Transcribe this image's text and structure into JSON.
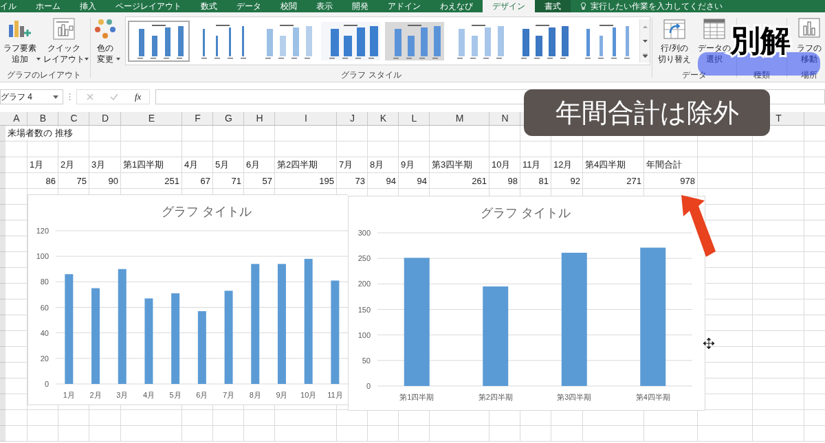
{
  "ribbon_tabs": [
    {
      "label": "イル",
      "selected": false,
      "contextual": false
    },
    {
      "label": "ホーム",
      "selected": false,
      "contextual": false
    },
    {
      "label": "挿入",
      "selected": false,
      "contextual": false
    },
    {
      "label": "ページレイアウト",
      "selected": false,
      "contextual": false
    },
    {
      "label": "数式",
      "selected": false,
      "contextual": false
    },
    {
      "label": "データ",
      "selected": false,
      "contextual": false
    },
    {
      "label": "校閲",
      "selected": false,
      "contextual": false
    },
    {
      "label": "表示",
      "selected": false,
      "contextual": false
    },
    {
      "label": "開発",
      "selected": false,
      "contextual": false
    },
    {
      "label": "アドイン",
      "selected": false,
      "contextual": false
    },
    {
      "label": "わえなび",
      "selected": false,
      "contextual": false
    },
    {
      "label": "デザイン",
      "selected": true,
      "contextual": true
    },
    {
      "label": "書式",
      "selected": false,
      "contextual": true
    }
  ],
  "tell_me": {
    "placeholder": "実行したい作業を入力してください"
  },
  "ribbon": {
    "layout_group": {
      "label": "グラフのレイアウト",
      "buttons": [
        {
          "lines": [
            "ラフ要素",
            "追加"
          ],
          "kind": "elements"
        },
        {
          "lines": [
            "クイック",
            "レイアウト"
          ],
          "kind": "layout"
        }
      ]
    },
    "style_group": {
      "label": "グラフ スタイル",
      "color_button": {
        "lines": [
          "色の",
          "変更"
        ]
      },
      "styles": [
        {
          "selected": true
        },
        {
          "selected": false
        },
        {
          "selected": false
        },
        {
          "selected": false
        },
        {
          "selected": false
        },
        {
          "selected": false
        },
        {
          "selected": false
        },
        {
          "selected": false
        }
      ]
    },
    "data_group": {
      "label": "データ",
      "buttons": [
        {
          "lines": [
            "行/列の",
            "切り替え"
          ],
          "kind": "switch"
        },
        {
          "lines": [
            "データの",
            "選択"
          ],
          "kind": "select"
        }
      ]
    },
    "type_group": {
      "label": "種類"
    },
    "location_group": {
      "label": "場所",
      "button": {
        "lines": [
          "ラフの",
          "移動"
        ]
      }
    }
  },
  "formula_bar": {
    "name_box": "グラフ 4",
    "function_label": "fx"
  },
  "column_headers": [
    "A",
    "B",
    "C",
    "D",
    "E",
    "F",
    "G",
    "H",
    "I",
    "J",
    "K",
    "L",
    "M",
    "N"
  ],
  "column_headers_right": [
    "T"
  ],
  "rows": [
    {
      "cells": [
        {
          "text": "来場者数の 推移",
          "kind": "text"
        },
        null,
        null,
        null,
        null,
        null,
        null,
        null,
        null,
        null,
        null,
        null,
        null,
        null,
        null,
        null,
        null,
        null,
        null,
        null
      ]
    },
    {
      "cells": [
        null,
        null,
        null,
        null,
        null,
        null,
        null,
        null,
        null,
        null,
        null,
        null,
        null,
        null,
        null,
        null,
        null,
        null,
        null,
        null
      ]
    },
    {
      "cells": [
        null,
        {
          "text": "1月",
          "kind": "text"
        },
        {
          "text": "2月",
          "kind": "text"
        },
        {
          "text": "3月",
          "kind": "text"
        },
        {
          "text": "第1四半期",
          "kind": "text"
        },
        {
          "text": "4月",
          "kind": "text"
        },
        {
          "text": "5月",
          "kind": "text"
        },
        {
          "text": "6月",
          "kind": "text"
        },
        {
          "text": "第2四半期",
          "kind": "text"
        },
        {
          "text": "7月",
          "kind": "text"
        },
        {
          "text": "8月",
          "kind": "text"
        },
        {
          "text": "9月",
          "kind": "text"
        },
        {
          "text": "第3四半期",
          "kind": "text"
        },
        {
          "text": "10月",
          "kind": "text"
        },
        {
          "text": "11月",
          "kind": "text"
        },
        {
          "text": "12月",
          "kind": "text"
        },
        {
          "text": "第4四半期",
          "kind": "text"
        },
        {
          "text": "年間合計",
          "kind": "text"
        },
        null,
        null
      ]
    },
    {
      "cells": [
        null,
        {
          "text": "86",
          "kind": "number"
        },
        {
          "text": "75",
          "kind": "number"
        },
        {
          "text": "90",
          "kind": "number"
        },
        {
          "text": "251",
          "kind": "number"
        },
        {
          "text": "67",
          "kind": "number"
        },
        {
          "text": "71",
          "kind": "number"
        },
        {
          "text": "57",
          "kind": "number"
        },
        {
          "text": "195",
          "kind": "number"
        },
        {
          "text": "73",
          "kind": "number"
        },
        {
          "text": "94",
          "kind": "number"
        },
        {
          "text": "94",
          "kind": "number"
        },
        {
          "text": "261",
          "kind": "number"
        },
        {
          "text": "98",
          "kind": "number"
        },
        {
          "text": "81",
          "kind": "number"
        },
        {
          "text": "92",
          "kind": "number"
        },
        {
          "text": "271",
          "kind": "number"
        },
        {
          "text": "978",
          "kind": "number"
        },
        null,
        null
      ]
    }
  ],
  "charts": [
    {
      "chart_data": {
        "type": "bar",
        "title": "グラフ タイトル",
        "categories": [
          "1月",
          "2月",
          "3月",
          "4月",
          "5月",
          "6月",
          "7月",
          "8月",
          "9月",
          "10月",
          "11月"
        ],
        "series": [
          {
            "color": "#5b9bd5",
            "values": [
              86,
              75,
              90,
              67,
              71,
              57,
              73,
              94,
              94,
              98,
              81
            ]
          }
        ],
        "ylim": [
          0,
          120
        ],
        "yticks": [
          0,
          20,
          40,
          60,
          80,
          100,
          120
        ],
        "grid": true
      }
    },
    {
      "chart_data": {
        "type": "bar",
        "title": "グラフ タイトル",
        "categories": [
          "第1四半期",
          "第2四半期",
          "第3四半期",
          "第4四半期"
        ],
        "series": [
          {
            "color": "#5b9bd5",
            "values": [
              251,
              195,
              261,
              271
            ]
          }
        ],
        "ylim": [
          0,
          300
        ],
        "yticks": [
          0,
          50,
          100,
          150,
          200,
          250,
          300
        ],
        "grid": true
      }
    }
  ],
  "captions": [
    {
      "text": "別解",
      "kind": "outlined"
    },
    {
      "text": "年間合計は除外",
      "kind": "boxed"
    }
  ]
}
